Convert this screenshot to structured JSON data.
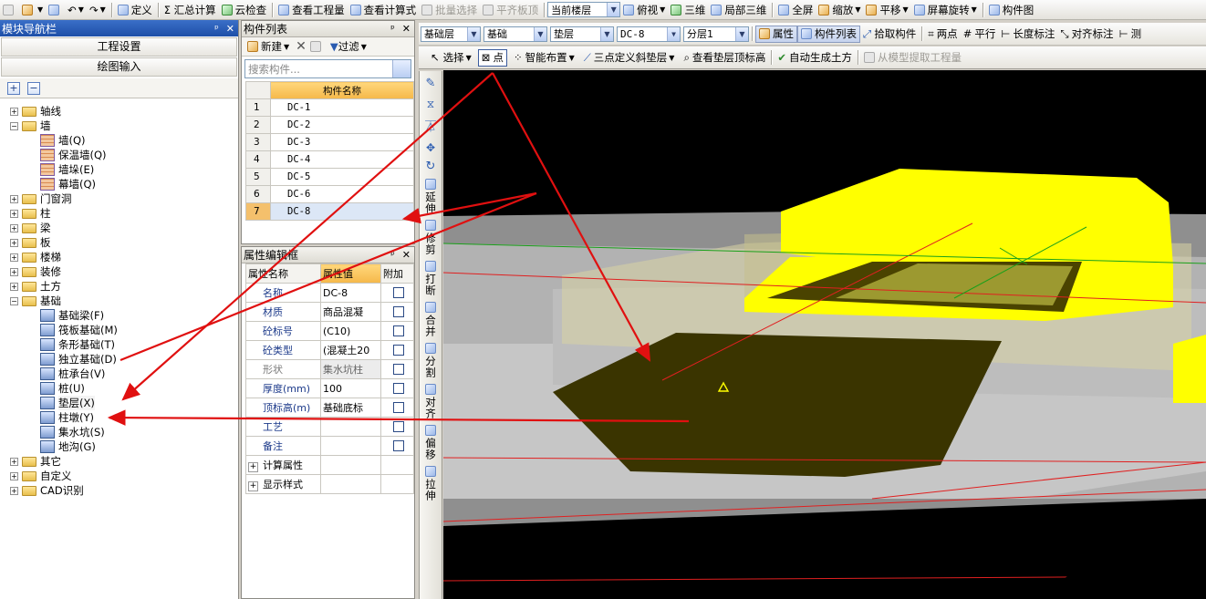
{
  "toolbar_main": {
    "define_label": "定义",
    "sum_calc_label": "Σ 汇总计算",
    "cloud_check_label": "云检查",
    "view_qty_label": "查看工程量",
    "view_formula_label": "查看计算式",
    "batch_select_label": "批量选择",
    "align_top_label": "平齐板顶",
    "floor_select_value": "当前楼层",
    "top_view_label": "俯视",
    "three_d_label": "三维",
    "local_3d_label": "局部三维",
    "fullscreen_label": "全屏",
    "zoom_label": "缩放",
    "pan_label": "平移",
    "rotate_label": "屏幕旋转",
    "component_diagram_label": "构件图"
  },
  "nav_panel": {
    "title": "模块导航栏",
    "btn_project_settings": "工程设置",
    "btn_drawing_input": "绘图输入",
    "tree": [
      {
        "label": "轴线",
        "expanded": false
      },
      {
        "label": "墙",
        "expanded": true,
        "children": [
          "墙(Q)",
          "保温墙(Q)",
          "墙垛(E)",
          "幕墙(Q)"
        ]
      },
      {
        "label": "门窗洞",
        "expanded": false
      },
      {
        "label": "柱",
        "expanded": false
      },
      {
        "label": "梁",
        "expanded": false
      },
      {
        "label": "板",
        "expanded": false
      },
      {
        "label": "楼梯",
        "expanded": false
      },
      {
        "label": "装修",
        "expanded": false
      },
      {
        "label": "土方",
        "expanded": false
      },
      {
        "label": "基础",
        "expanded": true,
        "children": [
          "基础梁(F)",
          "筏板基础(M)",
          "条形基础(T)",
          "独立基础(D)",
          "桩承台(V)",
          "桩(U)",
          "垫层(X)",
          "柱墩(Y)",
          "集水坑(S)",
          "地沟(G)"
        ]
      },
      {
        "label": "其它",
        "expanded": false
      },
      {
        "label": "自定义",
        "expanded": false
      },
      {
        "label": "CAD识别",
        "expanded": false
      }
    ]
  },
  "component_list": {
    "title": "构件列表",
    "new_label": "新建",
    "filter_label": "过滤",
    "search_placeholder": "搜索构件...",
    "header": "构件名称",
    "rows": [
      {
        "n": "1",
        "name": "DC-1"
      },
      {
        "n": "2",
        "name": "DC-2"
      },
      {
        "n": "3",
        "name": "DC-3"
      },
      {
        "n": "4",
        "name": "DC-4"
      },
      {
        "n": "5",
        "name": "DC-5"
      },
      {
        "n": "6",
        "name": "DC-6"
      },
      {
        "n": "7",
        "name": "DC-8"
      }
    ]
  },
  "attr_panel": {
    "title": "属性编辑框",
    "col_name": "属性名称",
    "col_value": "属性值",
    "col_extra": "附加",
    "rows": [
      {
        "name": "名称",
        "value": "DC-8"
      },
      {
        "name": "材质",
        "value": "商品混凝"
      },
      {
        "name": "砼标号",
        "value": "(C10)"
      },
      {
        "name": "砼类型",
        "value": "(混凝土20"
      },
      {
        "name": "形状",
        "value": "集水坑柱"
      },
      {
        "name": "厚度(mm)",
        "value": "100"
      },
      {
        "name": "顶标高(m)",
        "value": "基础底标"
      },
      {
        "name": "工艺",
        "value": ""
      },
      {
        "name": "备注",
        "value": ""
      }
    ],
    "groups": [
      "计算属性",
      "显示样式"
    ]
  },
  "toolbar_layer": {
    "layer_combo1": "基础层",
    "layer_combo2": "基础",
    "layer_combo3": "垫层",
    "layer_combo4": "DC-8",
    "layer_combo5": "分层1",
    "property_label": "属性",
    "component_list_label": "构件列表",
    "pick_label": "拾取构件",
    "two_point_label": "两点",
    "parallel_label": "平行",
    "length_mark_label": "长度标注",
    "align_mark_label": "对齐标注",
    "measure_label": "测"
  },
  "toolbar_draw": {
    "select_label": "选择",
    "point_label": "点",
    "smart_place_label": "智能布置",
    "three_point_label": "三点定义斜垫层",
    "view_top_label": "查看垫层顶标高",
    "auto_earth_label": "自动生成土方",
    "extract_label": "从模型提取工程量"
  },
  "side_tools": [
    "延伸",
    "修剪",
    "打断",
    "合并",
    "分割",
    "对齐",
    "偏移",
    "拉伸"
  ],
  "colors": {
    "title_blue": "#1e4fa8",
    "highlight_orange": "#f5b84a",
    "arrow_red": "#e01010",
    "slab_dark": "#3a3400",
    "yellow_body": "#ffff00"
  }
}
